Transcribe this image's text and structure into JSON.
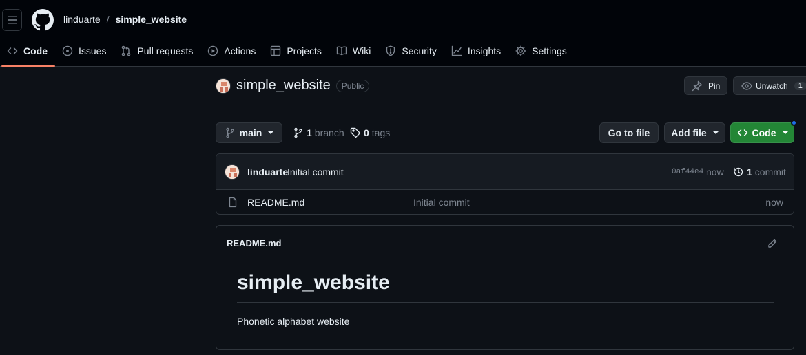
{
  "header": {
    "owner": "linduarte",
    "separator": "/",
    "repo": "simple_website"
  },
  "nav": {
    "tabs": [
      {
        "label": "Code",
        "icon": "code-icon",
        "active": true
      },
      {
        "label": "Issues",
        "icon": "issue-icon"
      },
      {
        "label": "Pull requests",
        "icon": "pull-request-icon"
      },
      {
        "label": "Actions",
        "icon": "play-icon"
      },
      {
        "label": "Projects",
        "icon": "table-icon"
      },
      {
        "label": "Wiki",
        "icon": "book-icon"
      },
      {
        "label": "Security",
        "icon": "shield-icon"
      },
      {
        "label": "Insights",
        "icon": "graph-icon"
      },
      {
        "label": "Settings",
        "icon": "gear-icon"
      }
    ]
  },
  "repo": {
    "name": "simple_website",
    "visibility": "Public",
    "pin_label": "Pin",
    "unwatch_label": "Unwatch",
    "watch_count": "1"
  },
  "toolbar": {
    "branch": "main",
    "branch_count": "1",
    "branch_word": "branch",
    "tag_count": "0",
    "tag_word": "tags",
    "goto_label": "Go to file",
    "add_file_label": "Add file",
    "code_label": "Code"
  },
  "commit": {
    "author": "linduarte",
    "message": "Initial commit",
    "sha": "0af44e4",
    "time": "now",
    "count": "1",
    "count_word": "commit"
  },
  "files": [
    {
      "name": "README.md",
      "message": "Initial commit",
      "time": "now"
    }
  ],
  "readme": {
    "label": "README.md",
    "heading": "simple_website",
    "paragraph": "Phonetic alphabet website"
  },
  "colors": {
    "background": "#0d1117",
    "header_bg": "#010409",
    "border": "#30363d",
    "accent_underline": "#f78166",
    "primary_button": "#238636",
    "notification_dot": "#1f6feb"
  }
}
